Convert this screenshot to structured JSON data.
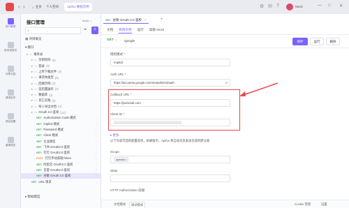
{
  "titlebar": {
    "back_label": "‹",
    "forward_label": "›",
    "home_label": "主页",
    "workspace_label": "个人空间",
    "project_tab": "Apifox 教程示例",
    "user_name": "Mock",
    "window_controls": [
      "—",
      "□",
      "✕"
    ]
  },
  "rail": {
    "items": [
      {
        "label": "接口管理"
      },
      {
        "label": "自动化测试"
      },
      {
        "label": "分享文档"
      },
      {
        "label": "请求历史"
      },
      {
        "label": "项目设置"
      },
      {
        "label": "邀请成员"
      }
    ]
  },
  "tree": {
    "project_title": "接口管理",
    "env_label": "mock",
    "search_placeholder": "",
    "add_label": "+",
    "overview_label": "项目概览",
    "interfaces_label": "接口",
    "rows": [
      {
        "indent": 0,
        "text": "根目录",
        "method": "",
        "count": ""
      },
      {
        "indent": 1,
        "text": "示例项目",
        "method": "",
        "count": "(6)"
      },
      {
        "indent": 1,
        "text": "登录",
        "method": "",
        "count": "(3)"
      },
      {
        "indent": 1,
        "text": "上传下载文件",
        "method": "",
        "count": "(2)"
      },
      {
        "indent": 1,
        "text": "请求体类型",
        "method": "",
        "count": "(5)"
      },
      {
        "indent": 1,
        "text": "回调示例",
        "method": "",
        "count": "(2)"
      },
      {
        "indent": 1,
        "text": "前后置操作",
        "method": "",
        "count": "(2)"
      },
      {
        "indent": 1,
        "text": "数据库",
        "method": "",
        "count": "(3)"
      },
      {
        "indent": 1,
        "text": "其它实践",
        "method": "",
        "count": "(3)"
      },
      {
        "indent": 1,
        "text": "导入导出文档",
        "method": "",
        "count": "(4)"
      },
      {
        "indent": 1,
        "text": "OAuth 2.0 鉴权",
        "method": "",
        "count": "(12)"
      },
      {
        "indent": 2,
        "text": "Authorization Code 模式",
        "method": "GET",
        "count": ""
      },
      {
        "indent": 2,
        "text": "implicit 模式",
        "method": "GET",
        "count": ""
      },
      {
        "indent": 2,
        "text": "Password 模式",
        "method": "GET",
        "count": ""
      },
      {
        "indent": 2,
        "text": "Client 模式",
        "method": "GET",
        "count": ""
      },
      {
        "indent": 2,
        "text": "企业微信",
        "method": "GET",
        "count": ""
      },
      {
        "indent": 2,
        "text": "飞书 OAuth2.0 鉴权",
        "method": "GET",
        "count": ""
      },
      {
        "indent": 2,
        "text": "钉钉 OAuth2.0 鉴权",
        "method": "GET",
        "count": ""
      },
      {
        "indent": 2,
        "text": "钉钉手动获取Token",
        "method": "POST",
        "count": ""
      },
      {
        "indent": 2,
        "text": "阿里云 OAuth2.0 鉴权",
        "method": "GET",
        "count": ""
      },
      {
        "indent": 2,
        "text": "百度 OAuth2.0 鉴权",
        "method": "GET",
        "count": ""
      },
      {
        "indent": 2,
        "text": "谷歌 OAuth 2.0 鉴权",
        "method": "GET",
        "count": "",
        "selected": true
      },
      {
        "indent": 1,
        "text": "URL 请求",
        "method": "GET",
        "count": ""
      }
    ],
    "models_label": "数据模型"
  },
  "main": {
    "tab_method": "GET",
    "tab_title": "谷歌 OAuth 2.0 鉴权",
    "subtabs": [
      "文档",
      "修改文档",
      "运行",
      "高级 Mock"
    ],
    "active_subtab": 1,
    "request_method": "GET",
    "request_url": "/google",
    "save_label": "保存",
    "run_label": "运行",
    "delete_label": "删除",
    "auth_mode_label": "授权模式",
    "auth_mode_value": "Implicit",
    "auth_url_label": "Auth URL",
    "auth_url_value": "https://accounts.google.com/o/oauth2/v2/auth",
    "callback_label": "Callback URL",
    "callback_value": "https://jovisclub.com",
    "client_id_label": "Client ID",
    "client_id_value": "▒▒▒▒▒▒▒▒▒▒▒▒▒▒▒▒▒▒▒▒▒▒▒▒▒▒▒▒▒▒▒▒▒▒▒▒▒▒",
    "more_label": "更多",
    "hint_text": "以下为非可选的配置选项，如果留空，Apifox 将自动为其发送合适的默认值",
    "scope_label": "Scope",
    "scope_tag": "openid",
    "state_label": "State",
    "header_label": "HTTP Authorization 前缀",
    "accent": "#7b61ff",
    "highlight_color": "#e5484d"
  },
  "statusbar": {
    "left_label": "文档模式",
    "mode_label": "调试模式",
    "cookie_label": "Cookie 管理",
    "settings_label": "设置"
  }
}
